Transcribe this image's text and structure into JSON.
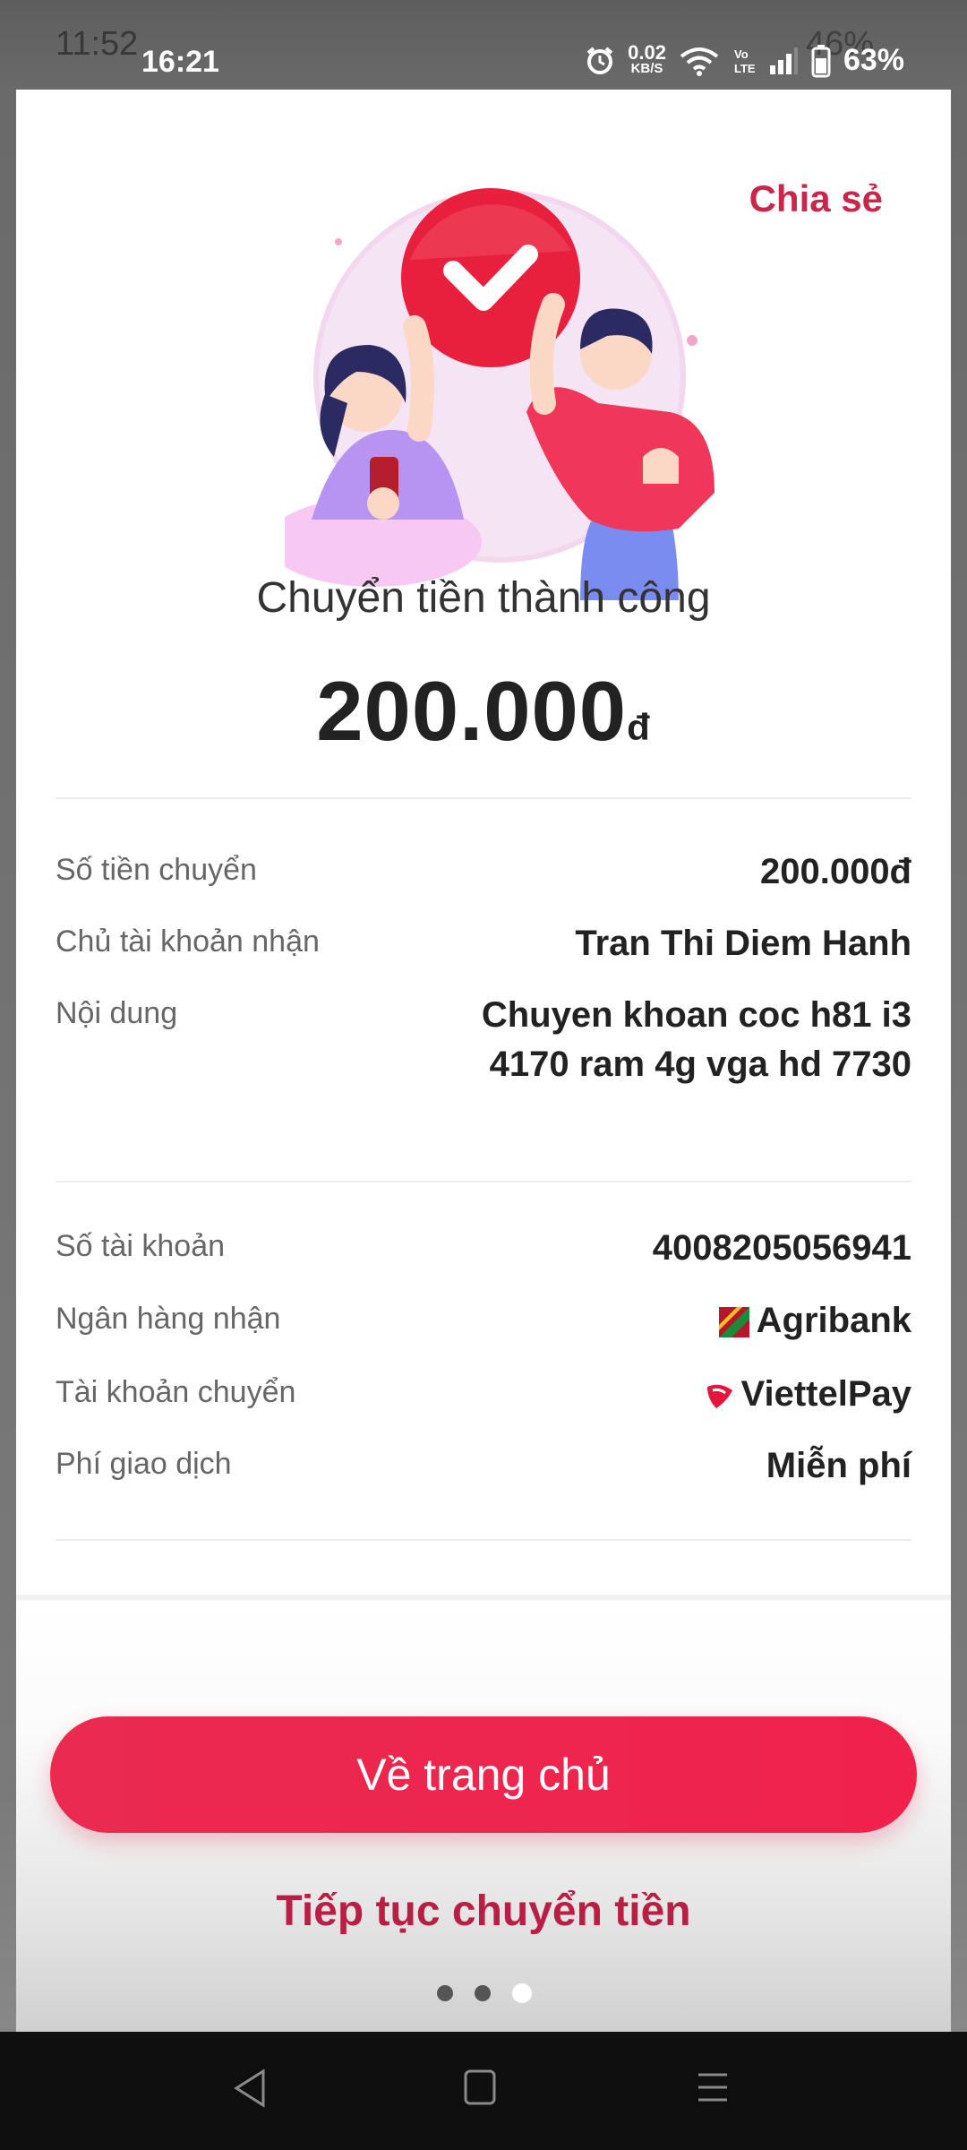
{
  "status": {
    "ghost_time": "11:52",
    "ghost_battery": "46%",
    "time": "16:21",
    "speed_value": "0.02",
    "speed_unit": "KB/S",
    "battery": "63%"
  },
  "header": {
    "share_label": "Chia sẻ"
  },
  "result": {
    "title": "Chuyển tiền thành công",
    "amount": "200.000",
    "currency": "đ"
  },
  "details_1": [
    {
      "label": "Số tiền chuyển",
      "value": "200.000đ"
    },
    {
      "label": "Chủ tài khoản nhận",
      "value": "Tran Thi Diem Hanh"
    },
    {
      "label": "Nội dung",
      "value": "Chuyen khoan coc h81 i3 4170 ram 4g vga hd 7730"
    }
  ],
  "details_2": [
    {
      "label": "Số tài khoản",
      "value": "4008205056941"
    },
    {
      "label": "Ngân hàng nhận",
      "value": "Agribank",
      "icon": "agribank-logo"
    },
    {
      "label": "Tài khoản chuyển",
      "value": "ViettelPay",
      "icon": "viettelpay-logo"
    },
    {
      "label": "Phí giao dịch",
      "value": "Miễn phí"
    }
  ],
  "actions": {
    "home_label": "Về trang chủ",
    "continue_label": "Tiếp tục chuyển tiền"
  },
  "colors": {
    "accent": "#ea2a4f",
    "accent_text": "#c8264a"
  }
}
